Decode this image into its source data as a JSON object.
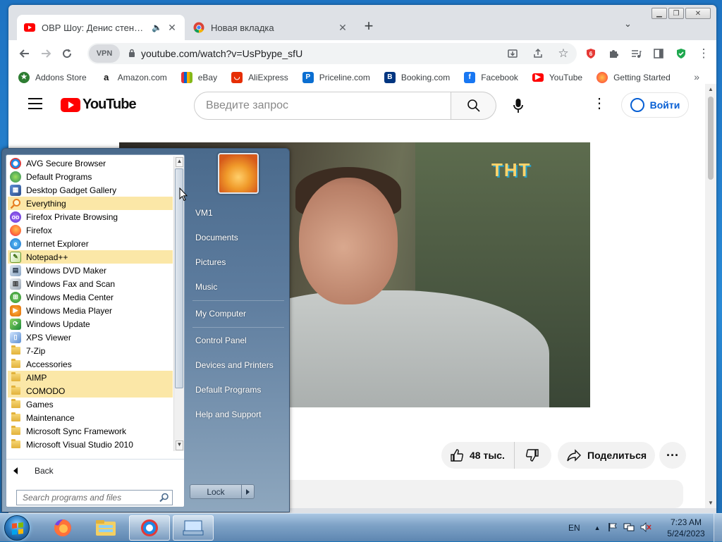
{
  "browser": {
    "tabs": [
      {
        "title": "ОВР Шоу: Денис стендапер",
        "active": true
      },
      {
        "title": "Новая вкладка",
        "active": false
      }
    ],
    "url": "youtube.com/watch?v=UsPbype_sfU",
    "vpn_label": "VPN",
    "bookmarks": [
      {
        "label": "Addons Store",
        "icon": "addons-icon",
        "color": "#2e7d32"
      },
      {
        "label": "Amazon.com",
        "icon": "amazon-icon",
        "color": "#111111"
      },
      {
        "label": "eBay",
        "icon": "ebay-icon",
        "color": "#e53238"
      },
      {
        "label": "AliExpress",
        "icon": "aliexpress-icon",
        "color": "#e62e04"
      },
      {
        "label": "Priceline.com",
        "icon": "priceline-icon",
        "color": "#0a6ed1"
      },
      {
        "label": "Booking.com",
        "icon": "booking-icon",
        "color": "#003580"
      },
      {
        "label": "Facebook",
        "icon": "facebook-icon",
        "color": "#1877f2"
      },
      {
        "label": "YouTube",
        "icon": "youtube-icon",
        "color": "#ff0000"
      },
      {
        "label": "Getting Started",
        "icon": "firefox-icon",
        "color": "#ff7139"
      }
    ]
  },
  "youtube": {
    "logo_text": "YouTube",
    "search_placeholder": "Введите запрос",
    "signin_label": "Войти",
    "likes": "48 тыс.",
    "share_label": "Поделиться",
    "video_watermark": "ТНТ"
  },
  "start_menu": {
    "programs": [
      {
        "label": "AVG Secure Browser",
        "type": "app",
        "icon": "avg-browser-icon",
        "highlight": false
      },
      {
        "label": "Default Programs",
        "type": "app",
        "icon": "default-programs-icon",
        "highlight": false
      },
      {
        "label": "Desktop Gadget Gallery",
        "type": "app",
        "icon": "gadget-gallery-icon",
        "highlight": false
      },
      {
        "label": "Everything",
        "type": "app",
        "icon": "everything-search-icon",
        "highlight": true
      },
      {
        "label": "Firefox Private Browsing",
        "type": "app",
        "icon": "firefox-private-icon",
        "highlight": false
      },
      {
        "label": "Firefox",
        "type": "app",
        "icon": "firefox-icon",
        "highlight": false
      },
      {
        "label": "Internet Explorer",
        "type": "app",
        "icon": "internet-explorer-icon",
        "highlight": false
      },
      {
        "label": "Notepad++",
        "type": "app",
        "icon": "notepadpp-icon",
        "highlight": true
      },
      {
        "label": "Windows DVD Maker",
        "type": "app",
        "icon": "dvd-maker-icon",
        "highlight": false
      },
      {
        "label": "Windows Fax and Scan",
        "type": "app",
        "icon": "fax-scan-icon",
        "highlight": false
      },
      {
        "label": "Windows Media Center",
        "type": "app",
        "icon": "media-center-icon",
        "highlight": false
      },
      {
        "label": "Windows Media Player",
        "type": "app",
        "icon": "media-player-icon",
        "highlight": false
      },
      {
        "label": "Windows Update",
        "type": "app",
        "icon": "windows-update-icon",
        "highlight": false
      },
      {
        "label": "XPS Viewer",
        "type": "app",
        "icon": "xps-viewer-icon",
        "highlight": false
      },
      {
        "label": "7-Zip",
        "type": "folder",
        "icon": "folder-icon",
        "highlight": false
      },
      {
        "label": "Accessories",
        "type": "folder",
        "icon": "folder-icon",
        "highlight": false
      },
      {
        "label": "AIMP",
        "type": "folder",
        "icon": "folder-icon",
        "highlight": true
      },
      {
        "label": "COMODO",
        "type": "folder",
        "icon": "folder-icon",
        "highlight": true
      },
      {
        "label": "Games",
        "type": "folder",
        "icon": "folder-icon",
        "highlight": false
      },
      {
        "label": "Maintenance",
        "type": "folder",
        "icon": "folder-icon",
        "highlight": false
      },
      {
        "label": "Microsoft Sync Framework",
        "type": "folder",
        "icon": "folder-icon",
        "highlight": false
      },
      {
        "label": "Microsoft Visual Studio 2010",
        "type": "folder",
        "icon": "folder-icon",
        "highlight": false
      }
    ],
    "back_label": "Back",
    "search_placeholder": "Search programs and files",
    "right_links": [
      "VM1",
      "Documents",
      "Pictures",
      "Music",
      "My Computer",
      "Control Panel",
      "Devices and Printers",
      "Default Programs",
      "Help and Support"
    ],
    "lock_label": "Lock"
  },
  "taskbar": {
    "language": "EN",
    "time": "7:23 AM",
    "date": "5/24/2023",
    "pinned": [
      "firefox-icon",
      "explorer-icon",
      "avg-browser-icon",
      "keyboard-app-icon"
    ]
  }
}
